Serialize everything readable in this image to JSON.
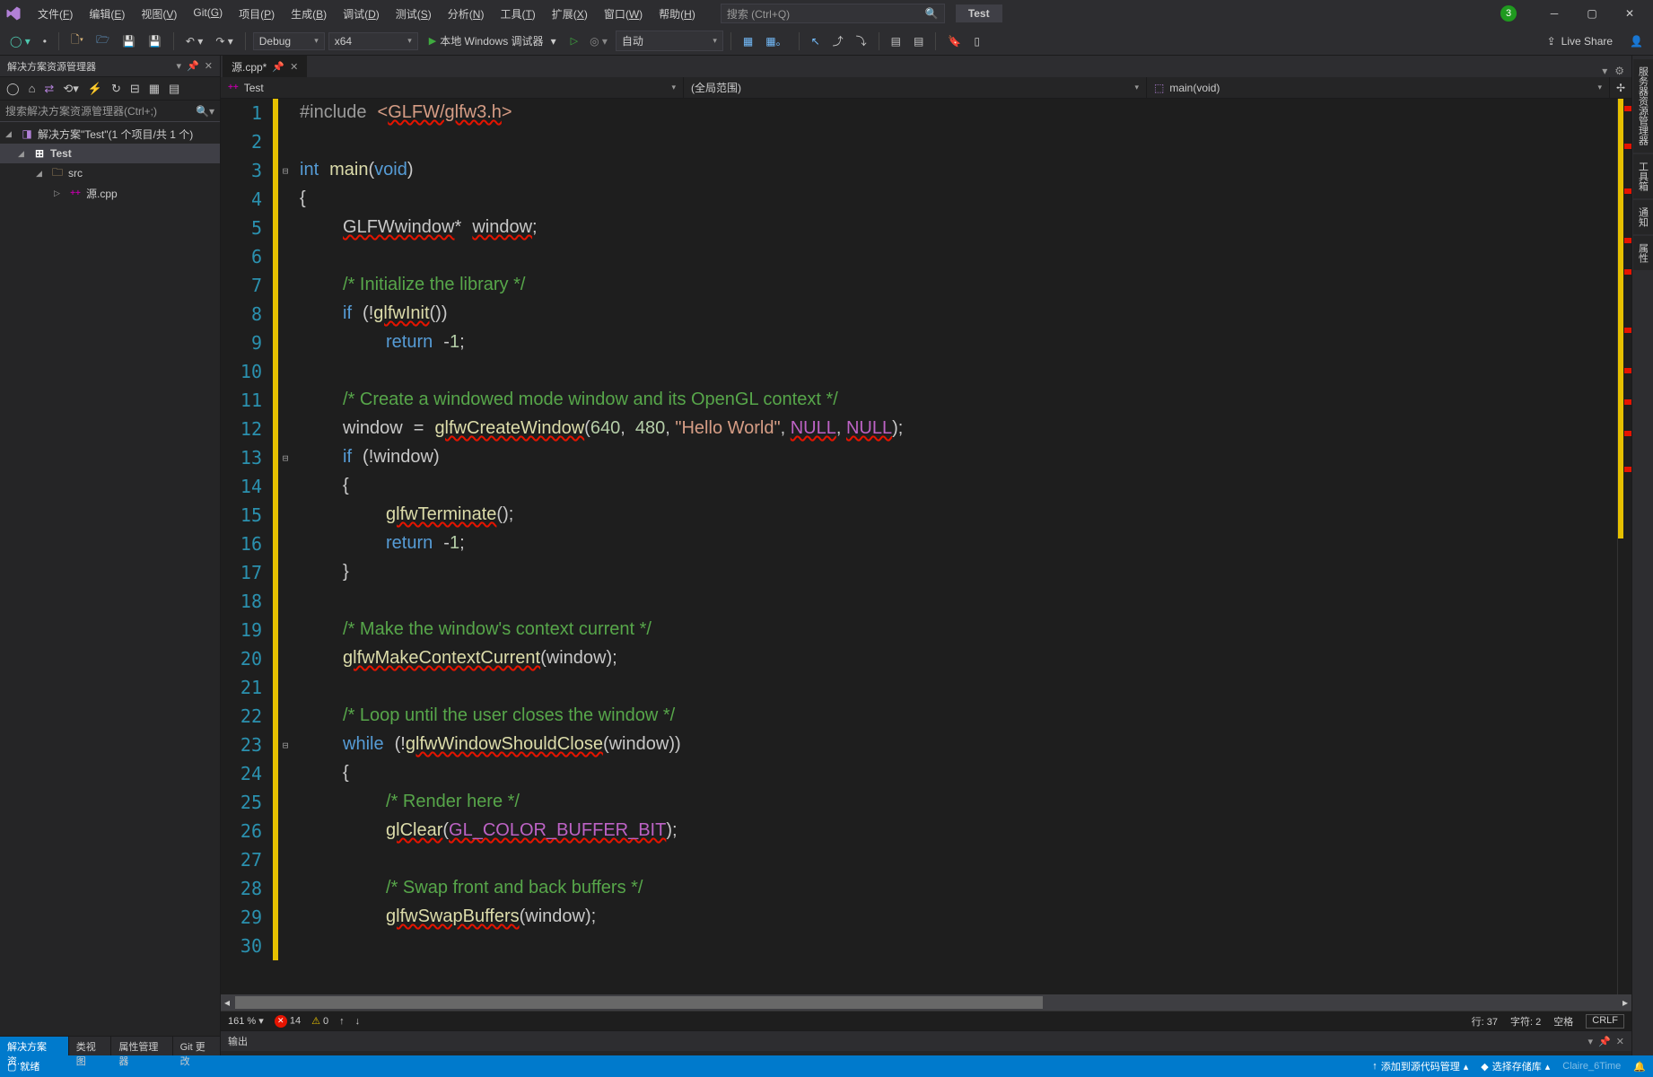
{
  "menu": [
    "文件(F)",
    "编辑(E)",
    "视图(V)",
    "Git(G)",
    "项目(P)",
    "生成(B)",
    "调试(D)",
    "测试(S)",
    "分析(N)",
    "工具(T)",
    "扩展(X)",
    "窗口(W)",
    "帮助(H)"
  ],
  "search_placeholder": "搜索 (Ctrl+Q)",
  "solution_label": "Test",
  "notif_count": "3",
  "config": "Debug",
  "platform": "x64",
  "run_label": "本地 Windows 调试器",
  "auto_label": "自动",
  "live_share": "Live Share",
  "solexp": {
    "title": "解决方案资源管理器",
    "search_placeholder": "搜索解决方案资源管理器(Ctrl+;)",
    "solution": "解决方案\"Test\"(1 个项目/共 1 个)",
    "project": "Test",
    "folder": "src",
    "file": "源.cpp"
  },
  "bottom_tabs": [
    "解决方案资...",
    "类视图",
    "属性管理器",
    "Git 更改"
  ],
  "doc_tab": "源.cpp*",
  "nav": {
    "proj": "Test",
    "scope": "(全局范围)",
    "func": "main(void)"
  },
  "code": [
    {
      "n": 1,
      "fold": "",
      "html": "<span class='pp'>#include</span> <span class='inc'>&lt;<span class='err'>GLFW/glfw3.h</span>&gt;</span>"
    },
    {
      "n": 2,
      "fold": "",
      "html": ""
    },
    {
      "n": 3,
      "fold": "⊟",
      "html": "<span class='kw'>int</span> <span class='func'>main</span><span class='paren'>(</span><span class='kw'>void</span><span class='paren'>)</span>"
    },
    {
      "n": 4,
      "fold": "",
      "html": "<span class='paren'>{</span>"
    },
    {
      "n": 5,
      "fold": "",
      "html": "    <span class='ident err'>GLFWwindow</span><span class='paren'>*</span> <span class='ident err'>window</span><span class='paren'>;</span>"
    },
    {
      "n": 6,
      "fold": "",
      "html": ""
    },
    {
      "n": 7,
      "fold": "",
      "html": "    <span class='com'>/* Initialize the library */</span>"
    },
    {
      "n": 8,
      "fold": "",
      "html": "    <span class='kw'>if</span> <span class='paren'>(!</span><span class='func err'>glfwInit</span><span class='paren'>())</span>"
    },
    {
      "n": 9,
      "fold": "",
      "html": "        <span class='kw'>return</span> <span class='paren'>-</span><span class='num'>1</span><span class='paren'>;</span>"
    },
    {
      "n": 10,
      "fold": "",
      "html": ""
    },
    {
      "n": 11,
      "fold": "",
      "html": "    <span class='com'>/* Create a windowed mode window and its OpenGL context */</span>"
    },
    {
      "n": 12,
      "fold": "",
      "html": "    <span class='ident'>window</span> <span class='paren'>=</span> <span class='func err'>glfwCreateWindow</span><span class='paren'>(</span><span class='num'>640</span><span class='paren'>,  </span><span class='num'>480</span><span class='paren'>, </span><span class='str'>\"Hello World\"</span><span class='paren'>, </span><span class='macro err'>NULL</span><span class='paren'>, </span><span class='macro err'>NULL</span><span class='paren'>);</span>"
    },
    {
      "n": 13,
      "fold": "⊟",
      "html": "    <span class='kw'>if</span> <span class='paren'>(!</span><span class='ident'>window</span><span class='paren'>)</span>"
    },
    {
      "n": 14,
      "fold": "",
      "html": "    <span class='paren'>{</span>"
    },
    {
      "n": 15,
      "fold": "",
      "html": "        <span class='func err'>glfwTerminate</span><span class='paren'>();</span>"
    },
    {
      "n": 16,
      "fold": "",
      "html": "        <span class='kw'>return</span> <span class='paren'>-</span><span class='num'>1</span><span class='paren'>;</span>"
    },
    {
      "n": 17,
      "fold": "",
      "html": "    <span class='paren'>}</span>"
    },
    {
      "n": 18,
      "fold": "",
      "html": ""
    },
    {
      "n": 19,
      "fold": "",
      "html": "    <span class='com'>/* Make the window's context current */</span>"
    },
    {
      "n": 20,
      "fold": "",
      "html": "    <span class='func err'>glfwMakeContextCurrent</span><span class='paren'>(</span><span class='ident'>window</span><span class='paren'>);</span>"
    },
    {
      "n": 21,
      "fold": "",
      "html": ""
    },
    {
      "n": 22,
      "fold": "",
      "html": "    <span class='com'>/* Loop until the user closes the window */</span>"
    },
    {
      "n": 23,
      "fold": "⊟",
      "html": "    <span class='kw'>while</span> <span class='paren'>(!</span><span class='func err'>glfwWindowShouldClose</span><span class='paren'>(</span><span class='ident'>window</span><span class='paren'>))</span>"
    },
    {
      "n": 24,
      "fold": "",
      "html": "    <span class='paren'>{</span>"
    },
    {
      "n": 25,
      "fold": "",
      "html": "        <span class='com'>/* Render here */</span>"
    },
    {
      "n": 26,
      "fold": "",
      "html": "        <span class='func err'>glClear</span><span class='paren'>(</span><span class='macro err'>GL_COLOR_BUFFER_BIT</span><span class='paren'>);</span>"
    },
    {
      "n": 27,
      "fold": "",
      "html": ""
    },
    {
      "n": 28,
      "fold": "",
      "html": "        <span class='com'>/* Swap front and back buffers */</span>"
    },
    {
      "n": 29,
      "fold": "",
      "html": "        <span class='func err'>glfwSwapBuffers</span><span class='paren'>(</span><span class='ident'>window</span><span class='paren'>);</span>"
    },
    {
      "n": 30,
      "fold": "",
      "html": ""
    }
  ],
  "editor_status": {
    "zoom": "161 %",
    "errors": "14",
    "warnings": "0",
    "line": "行: 37",
    "col": "字符: 2",
    "spaces": "空格",
    "eol": "CRLF"
  },
  "output_title": "输出",
  "right_tabs": [
    "服务器资源管理器",
    "工具箱",
    "通知",
    "属性"
  ],
  "statusbar": {
    "ready": "就绪",
    "source": "添加到源代码管理",
    "repo": "选择存储库",
    "watermark": "Claire_6Time"
  }
}
